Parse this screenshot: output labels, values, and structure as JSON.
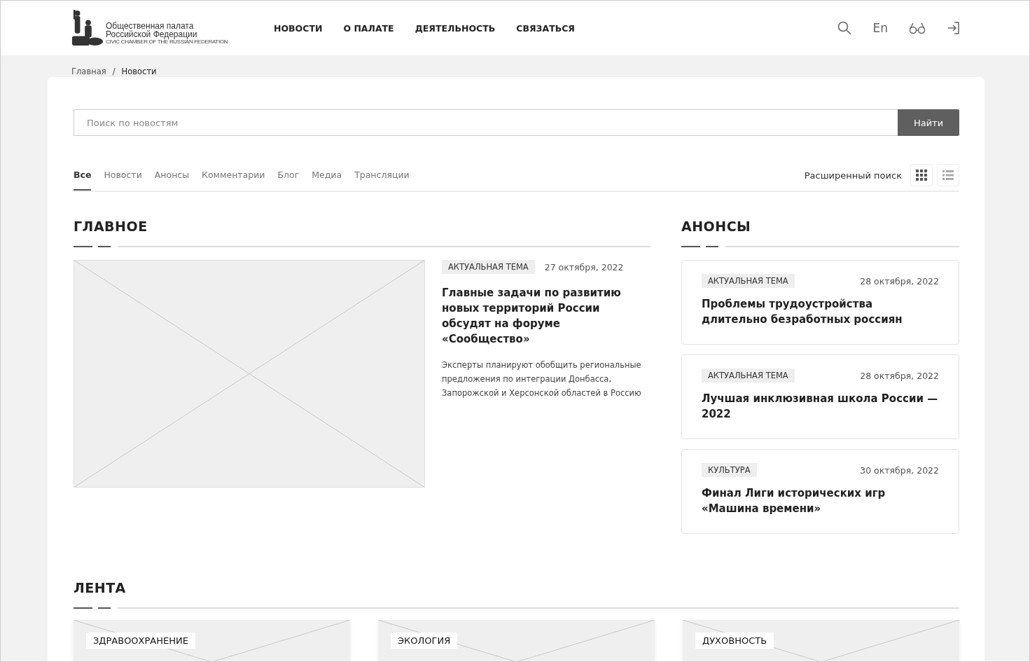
{
  "header": {
    "logo": {
      "line1": "Общественная палата",
      "line2": "Российской Федерации",
      "line3": "CIVIC CHAMBER OF THE RUSSIAN FEDERATION"
    },
    "nav": [
      "НОВОСТИ",
      "О ПАЛАТЕ",
      "ДЕЯТЕЛЬНОСТЬ",
      "СВЯЗАТЬСЯ"
    ],
    "language": "En"
  },
  "breadcrumbs": {
    "items": [
      "Главная",
      "Новости"
    ],
    "separator": "/"
  },
  "search": {
    "placeholder": "Поиск по новостям",
    "button": "Найти"
  },
  "tabs": [
    {
      "label": "Все",
      "selected": true
    },
    {
      "label": "Новости",
      "selected": false
    },
    {
      "label": "Анонсы",
      "selected": false
    },
    {
      "label": "Комментарии",
      "selected": false
    },
    {
      "label": "Блог",
      "selected": false
    },
    {
      "label": "Медиа",
      "selected": false
    },
    {
      "label": "Трансляции",
      "selected": false
    }
  ],
  "advanced_search": "Расширенный поиск",
  "views": [
    {
      "kind": "grid",
      "selected": true
    },
    {
      "kind": "list",
      "selected": false
    }
  ],
  "main": {
    "title": "ГЛАВНОЕ",
    "article": {
      "tag": "АКТУАЛЬНАЯ ТЕМА",
      "date": "27 октября, 2022",
      "headline": "Главные задачи по развитию новых территорий России обсудят на форуме «Сообщество»",
      "summary": "Эксперты планируют обобщить региональные предложения по интеграции Донбасса, Запорожской и Херсонской областей в Россию"
    }
  },
  "announcements": {
    "title": "АНОНСЫ",
    "items": [
      {
        "tag": "АКТУАЛЬНАЯ ТЕМА",
        "date": "28 октября, 2022",
        "headline": "Проблемы трудоустройства длительно безработных россиян"
      },
      {
        "tag": "АКТУАЛЬНАЯ ТЕМА",
        "date": "28 октября, 2022",
        "headline": "Лучшая инклюзивная школа России — 2022"
      },
      {
        "tag": "КУЛЬТУРА",
        "date": "30 октября, 2022",
        "headline": "Финал Лиги исторических игр «Машина времени»"
      }
    ]
  },
  "feed": {
    "title": "ЛЕНТА",
    "cards": [
      {
        "tag": "ЗДРАВООХРАНЕНИЕ"
      },
      {
        "tag": "ЭКОЛОГИЯ"
      },
      {
        "tag": "ДУХОВНОСТЬ"
      }
    ]
  }
}
